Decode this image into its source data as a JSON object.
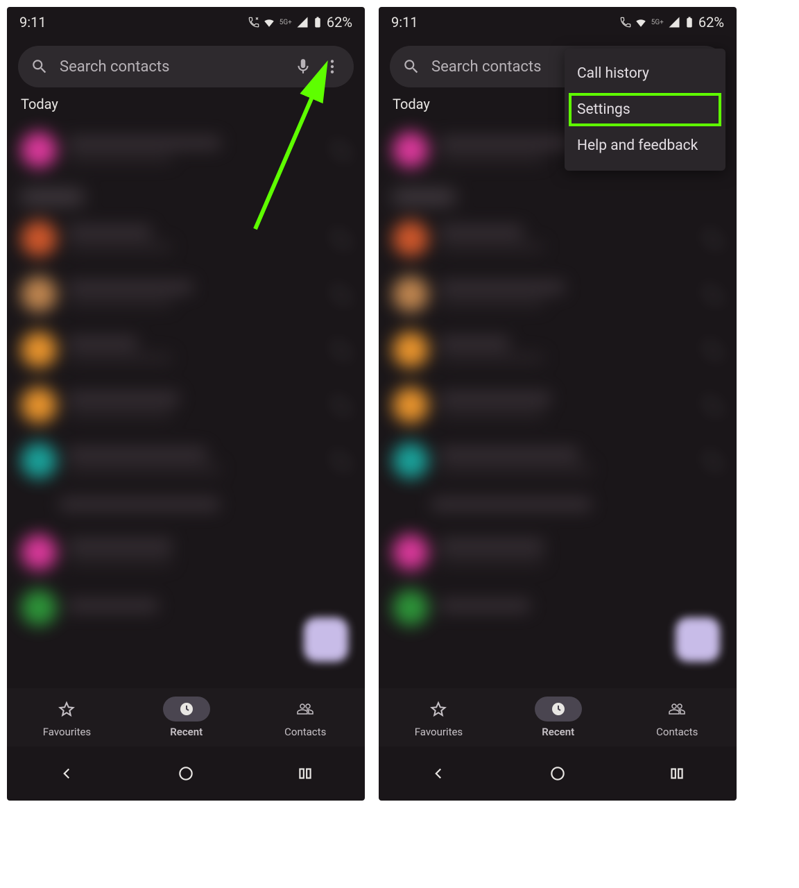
{
  "statusbar": {
    "time": "9:11",
    "network_label": "5G+",
    "battery": "62%"
  },
  "searchbar": {
    "placeholder": "Search contacts"
  },
  "section": {
    "today": "Today"
  },
  "call_rows": [
    {
      "avatar_color": "#e23aa0"
    },
    {
      "avatar_color": "#d65a2c"
    },
    {
      "avatar_color": "#c78b52"
    },
    {
      "avatar_color": "#f29a2e"
    },
    {
      "avatar_color": "#f29a2e"
    },
    {
      "avatar_color": "#1aa8a0"
    },
    {
      "avatar_color": "#e23aa0"
    },
    {
      "avatar_color": "#2e9a3a"
    }
  ],
  "popup": {
    "items": [
      {
        "label": "Call history"
      },
      {
        "label": "Settings",
        "highlighted": true
      },
      {
        "label": "Help and feedback"
      }
    ]
  },
  "bottomnav": {
    "favourites": "Favourites",
    "recent": "Recent",
    "contacts": "Contacts"
  },
  "annotation": {
    "highlight_color": "#5eff00"
  }
}
